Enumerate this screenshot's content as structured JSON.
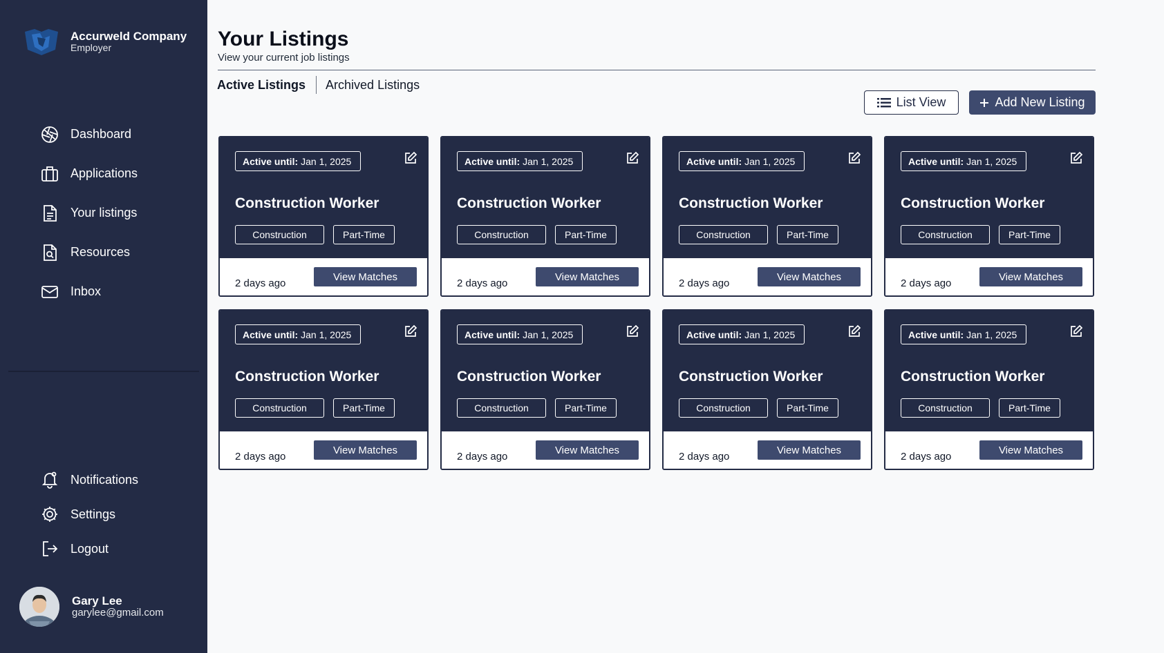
{
  "brand": {
    "name": "Accurweld Company",
    "role": "Employer"
  },
  "nav": [
    {
      "label": "Dashboard",
      "icon": "dashboard-icon"
    },
    {
      "label": "Applications",
      "icon": "briefcase-icon"
    },
    {
      "label": "Your listings",
      "icon": "document-icon"
    },
    {
      "label": "Resources",
      "icon": "file-search-icon"
    },
    {
      "label": "Inbox",
      "icon": "mail-icon"
    }
  ],
  "nav_bottom": [
    {
      "label": "Notifications",
      "icon": "bell-icon"
    },
    {
      "label": "Settings",
      "icon": "gear-icon"
    },
    {
      "label": "Logout",
      "icon": "logout-icon"
    }
  ],
  "user": {
    "name": "Gary Lee",
    "email": "garylee@gmail.com"
  },
  "page": {
    "title": "Your Listings",
    "subtitle": "View your current job listings"
  },
  "tabs": [
    {
      "label": "Active Listings",
      "active": true
    },
    {
      "label": "Archived Listings",
      "active": false
    }
  ],
  "toolbar": {
    "list_view_label": "List View",
    "add_listing_label": "Add New Listing"
  },
  "listings": [
    {
      "active_prefix": "Active until:",
      "active_date": "Jan 1, 2025",
      "title": "Construction Worker",
      "tags": [
        "Construction",
        "Part-Time"
      ],
      "posted": "2 days ago",
      "action": "View Matches"
    },
    {
      "active_prefix": "Active until:",
      "active_date": "Jan 1, 2025",
      "title": "Construction Worker",
      "tags": [
        "Construction",
        "Part-Time"
      ],
      "posted": "2 days ago",
      "action": "View Matches"
    },
    {
      "active_prefix": "Active until:",
      "active_date": "Jan 1, 2025",
      "title": "Construction Worker",
      "tags": [
        "Construction",
        "Part-Time"
      ],
      "posted": "2 days ago",
      "action": "View Matches"
    },
    {
      "active_prefix": "Active until:",
      "active_date": "Jan 1, 2025",
      "title": "Construction Worker",
      "tags": [
        "Construction",
        "Part-Time"
      ],
      "posted": "2 days ago",
      "action": "View Matches"
    },
    {
      "active_prefix": "Active until:",
      "active_date": "Jan 1, 2025",
      "title": "Construction Worker",
      "tags": [
        "Construction",
        "Part-Time"
      ],
      "posted": "2 days ago",
      "action": "View Matches"
    },
    {
      "active_prefix": "Active until:",
      "active_date": "Jan 1, 2025",
      "title": "Construction Worker",
      "tags": [
        "Construction",
        "Part-Time"
      ],
      "posted": "2 days ago",
      "action": "View Matches"
    },
    {
      "active_prefix": "Active until:",
      "active_date": "Jan 1, 2025",
      "title": "Construction Worker",
      "tags": [
        "Construction",
        "Part-Time"
      ],
      "posted": "2 days ago",
      "action": "View Matches"
    },
    {
      "active_prefix": "Active until:",
      "active_date": "Jan 1, 2025",
      "title": "Construction Worker",
      "tags": [
        "Construction",
        "Part-Time"
      ],
      "posted": "2 days ago",
      "action": "View Matches"
    }
  ],
  "colors": {
    "sidebar": "#232b45",
    "accent_button": "#3e4a6e",
    "background": "#f8f9fa",
    "card_header": "#232b45"
  }
}
